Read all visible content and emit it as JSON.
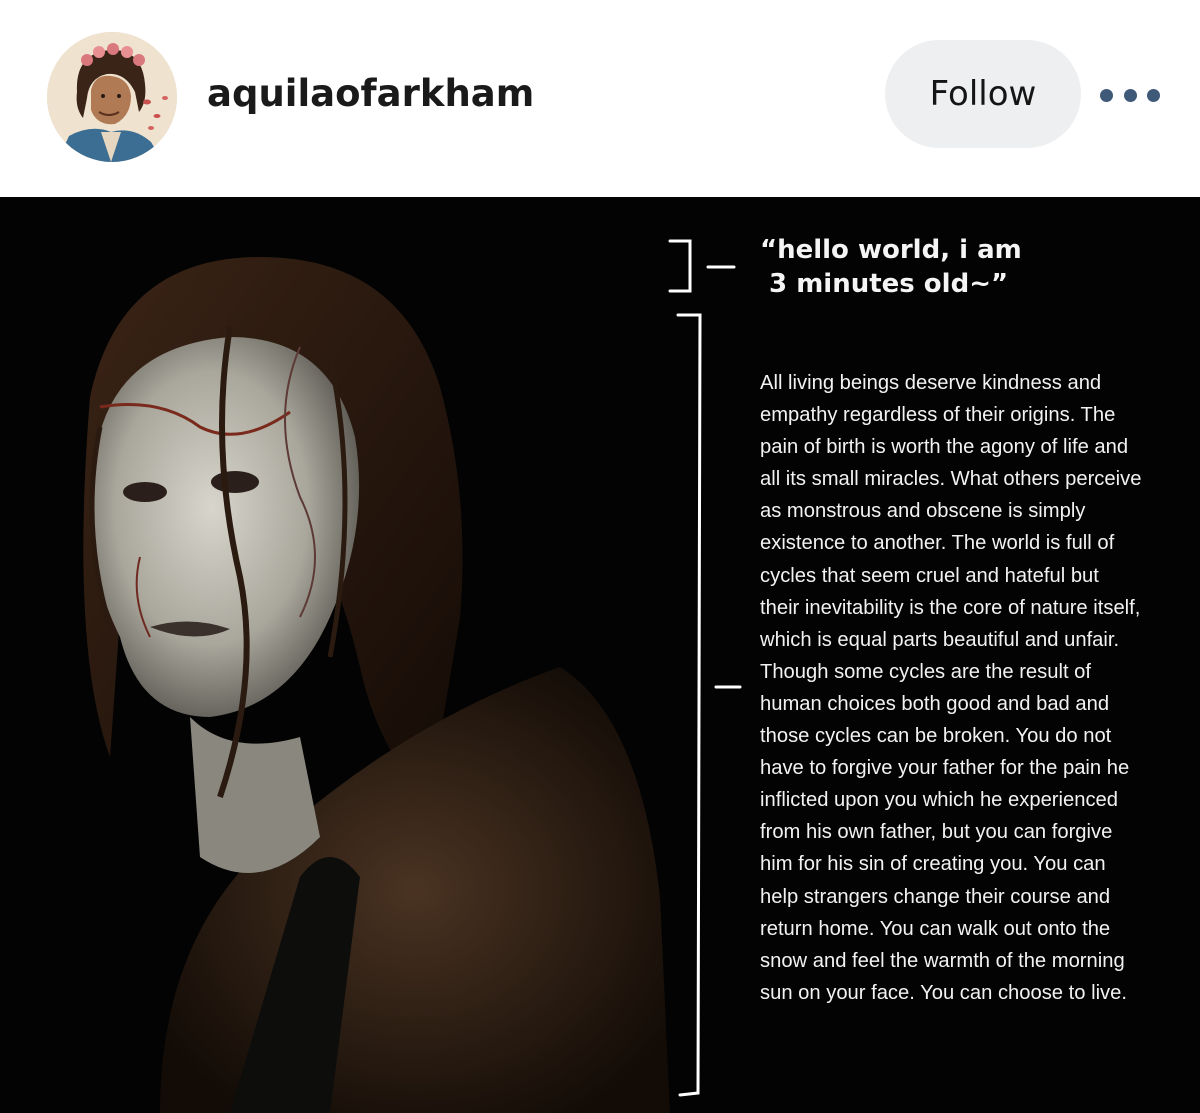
{
  "post_header": {
    "username": "aquilaofarkham",
    "follow_label": "Follow",
    "more_icon": "more-dots-icon"
  },
  "post_image": {
    "caption_title": "“hello world, i am\n 3 minutes old~”",
    "caption_lines": [
      "All living beings deserve kindness and",
      "empathy regardless of their origins. The",
      "pain of birth is worth the agony of life and",
      "all its small miracles. What others perceive",
      "as monstrous and obscene is simply",
      "existence to another. The world is full of",
      "cycles that seem cruel and hateful but",
      "their inevitability is the core of nature itself,",
      "which is equal parts beautiful and unfair.",
      "Though some cycles are the result of",
      "human choices both good and bad and",
      "those cycles can be broken. You do not",
      "have to forgive your father for the pain he",
      "inflicted upon you which he experienced",
      "from his own father, but you can forgive",
      "him for his sin of creating you. You can",
      "help strangers change their course and",
      "return home. You can walk out onto the",
      "snow and feel the warmth of the morning",
      "sun on your face. You can choose to live."
    ]
  },
  "colors": {
    "follow_bg": "#eeeff1",
    "dots": "#3f5a78",
    "image_bg": "#030303"
  }
}
